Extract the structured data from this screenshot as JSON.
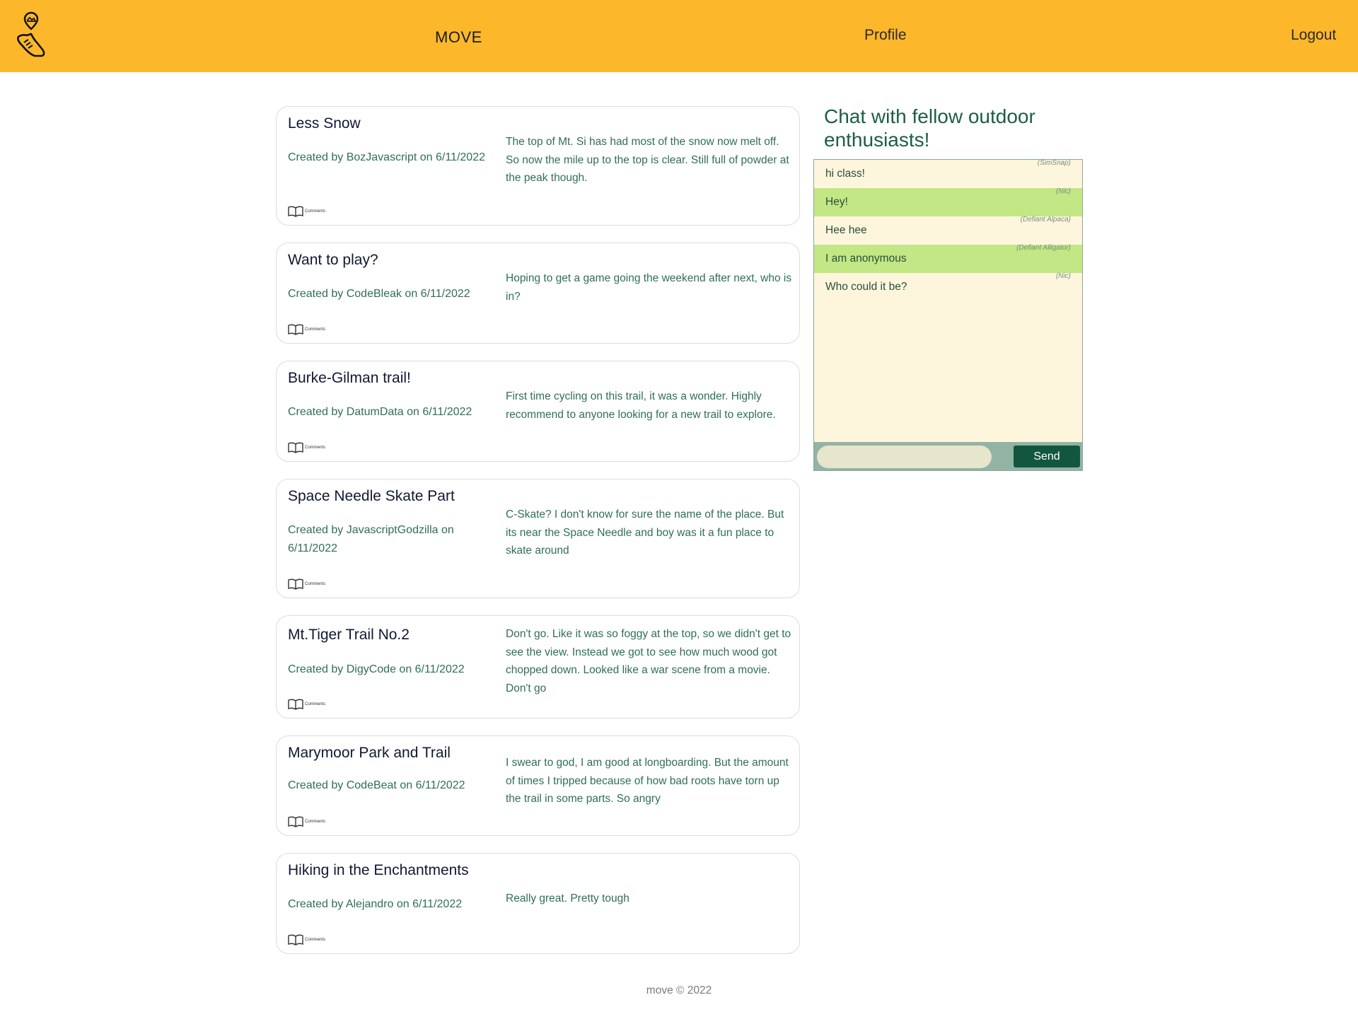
{
  "header": {
    "brand": "MOVE",
    "profile": "Profile",
    "logout": "Logout",
    "logo_icon": "running-shoe-location-icon",
    "background": "#fdb72b"
  },
  "posts": [
    {
      "title": "Less Snow",
      "meta": "Created by BozJavascript on 6/11/2022",
      "body": "The top of Mt. Si has had most of the snow now melt off. So now the mile up to the top is clear. Still full of powder at the peak though.",
      "comments_label": "Comments"
    },
    {
      "title": "Want to play?",
      "meta": "Created by CodeBleak on 6/11/2022",
      "body": "Hoping to get a game going the weekend after next, who is in?",
      "comments_label": "Comments"
    },
    {
      "title": "Burke-Gilman trail!",
      "meta": "Created by DatumData on 6/11/2022",
      "body": "First time cycling on this trail, it was a wonder. Highly recommend to anyone looking for a new trail to explore.",
      "comments_label": "Comments"
    },
    {
      "title": "Space Needle Skate Part",
      "meta": "Created by JavascriptGodzilla on 6/11/2022",
      "body": "C-Skate? I don't know for sure the name of the place. But its near the Space Needle and boy was it a fun place to skate around",
      "comments_label": "Comments"
    },
    {
      "title": "Mt.Tiger Trail No.2",
      "meta": "Created by DigyCode on 6/11/2022",
      "body": "Don't go. Like it was so foggy at the top, so we didn't get to see the view. Instead we got to see how much wood got chopped down. Looked like a war scene from a movie. Don't go",
      "comments_label": "Comments"
    },
    {
      "title": "Marymoor Park and Trail",
      "meta": "Created by CodeBeat on 6/11/2022",
      "body": "I swear to god, I am good at longboarding. But the amount of times I tripped because of how bad roots have torn up the trail in some parts. So angry",
      "comments_label": "Comments"
    },
    {
      "title": "Hiking in the Enchantments",
      "meta": "Created by Alejandro on 6/11/2022",
      "body": "Really great. Pretty tough",
      "comments_label": "Comments"
    }
  ],
  "chat": {
    "title": "Chat with fellow outdoor enthusiasts!",
    "messages": [
      {
        "text": "hi class!",
        "from": "(SimSnap)"
      },
      {
        "text": "Hey!",
        "from": "(Nic)"
      },
      {
        "text": "Hee hee",
        "from": "(Defiant Alpaca)"
      },
      {
        "text": "I am anonymous",
        "from": "(Defiant Alligator)"
      },
      {
        "text": "Who could it be?",
        "from": "(Nic)"
      }
    ],
    "input_value": "",
    "input_placeholder": "",
    "send_label": "Send",
    "colors": {
      "panel": "#fdf6dd",
      "highlight": "#c2e784",
      "button": "#13563f"
    }
  },
  "footer": {
    "text": "move © 2022"
  }
}
